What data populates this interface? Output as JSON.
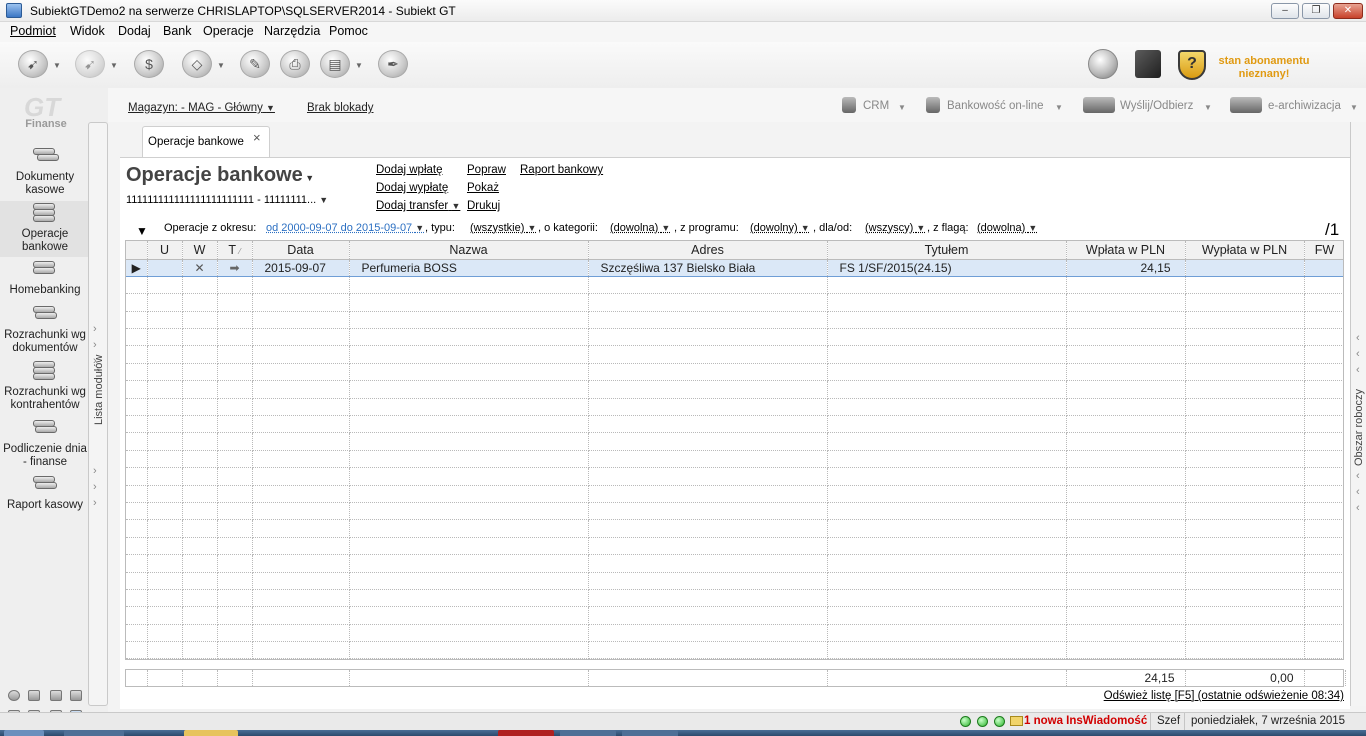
{
  "window": {
    "title": "SubiektGTDemo2 na serwerze CHRISLAPTOP\\SQLSERVER2014 - Subiekt GT",
    "min": "–",
    "max": "❐",
    "close": "✕"
  },
  "menu": [
    "Podmiot",
    "Widok",
    "Dodaj",
    "Bank",
    "Operacje",
    "Narzędzia",
    "Pomoc"
  ],
  "toolbar": {
    "icons": [
      "new-document-icon",
      "recent-documents-icon",
      "calculator-icon",
      "rubber-stamp-icon",
      "print-icon",
      "scan-icon",
      "cash-register-icon",
      "pen-icon"
    ],
    "subscription": "stan abonamentu nieznany!",
    "shield_glyph": "?"
  },
  "leftpanel": {
    "logo": "GT",
    "section": "Finanse",
    "modules": [
      "Dokumenty kasowe",
      "Operacje bankowe",
      "Homebanking",
      "Rozrachunki wg dokumentów",
      "Rozrachunki wg kontrahentów",
      "Podliczenie dnia - finanse",
      "Raport kasowy"
    ],
    "active_index": 1,
    "vertical_label": "Lista modułów"
  },
  "rightpanel": {
    "vertical_label": "Obszar roboczy"
  },
  "strip": {
    "warehouse": "Magazyn: - MAG - Główny",
    "lock": "Brak blokady",
    "tools": [
      "CRM",
      "Bankowość on-line",
      "Wyślij/Odbierz",
      "e-archiwizacja"
    ]
  },
  "tab": {
    "label": "Operacje bankowe",
    "close": "×"
  },
  "main": {
    "title": "Operacje bankowe",
    "account": "111111111111111111111111 - 11111111...",
    "actions": {
      "add_deposit": "Dodaj wpłatę",
      "add_withdrawal": "Dodaj wypłatę",
      "add_transfer": "Dodaj transfer",
      "edit": "Popraw",
      "show": "Pokaż",
      "print": "Drukuj",
      "bank_report": "Raport bankowy"
    },
    "filters": {
      "period_label": "Operacje z okresu:",
      "period_value": "od 2000-09-07 do 2015-09-07",
      "type_label": ", typu:",
      "type_value": "(wszystkie)",
      "category_label": ", o kategorii:",
      "category_value": "(dowolna)",
      "program_label": ", z programu:",
      "program_value": "(dowolny)",
      "for_label": ", dla/od:",
      "for_value": "(wszyscy)",
      "flag_label": ", z flagą:",
      "flag_value": "(dowolna)"
    },
    "page": "/1",
    "columns": [
      "",
      "U",
      "W",
      "T",
      "Data",
      "Nazwa",
      "Adres",
      "Tytułem",
      "Wpłata w PLN",
      "Wypłata w PLN",
      "FW"
    ],
    "rows": [
      {
        "pointer": "▶",
        "u": "",
        "w": "✕",
        "t": "➡",
        "date": "2015-09-07",
        "name": "Perfumeria BOSS",
        "address": "Szczęśliwa  137  Bielsko Biała",
        "title": "FS 1/SF/2015(24.15)",
        "deposit": "24,15",
        "withdrawal": "",
        "fw": ""
      }
    ],
    "totals": {
      "deposit": "24,15",
      "withdrawal": "0,00"
    },
    "refresh": "Odśwież listę [F5] (ostatnie odświeżenie 08:34)"
  },
  "status": {
    "message": "1 nowa InsWiadomość",
    "user": "Szef",
    "date": "poniedziałek, 7 września 2015"
  }
}
